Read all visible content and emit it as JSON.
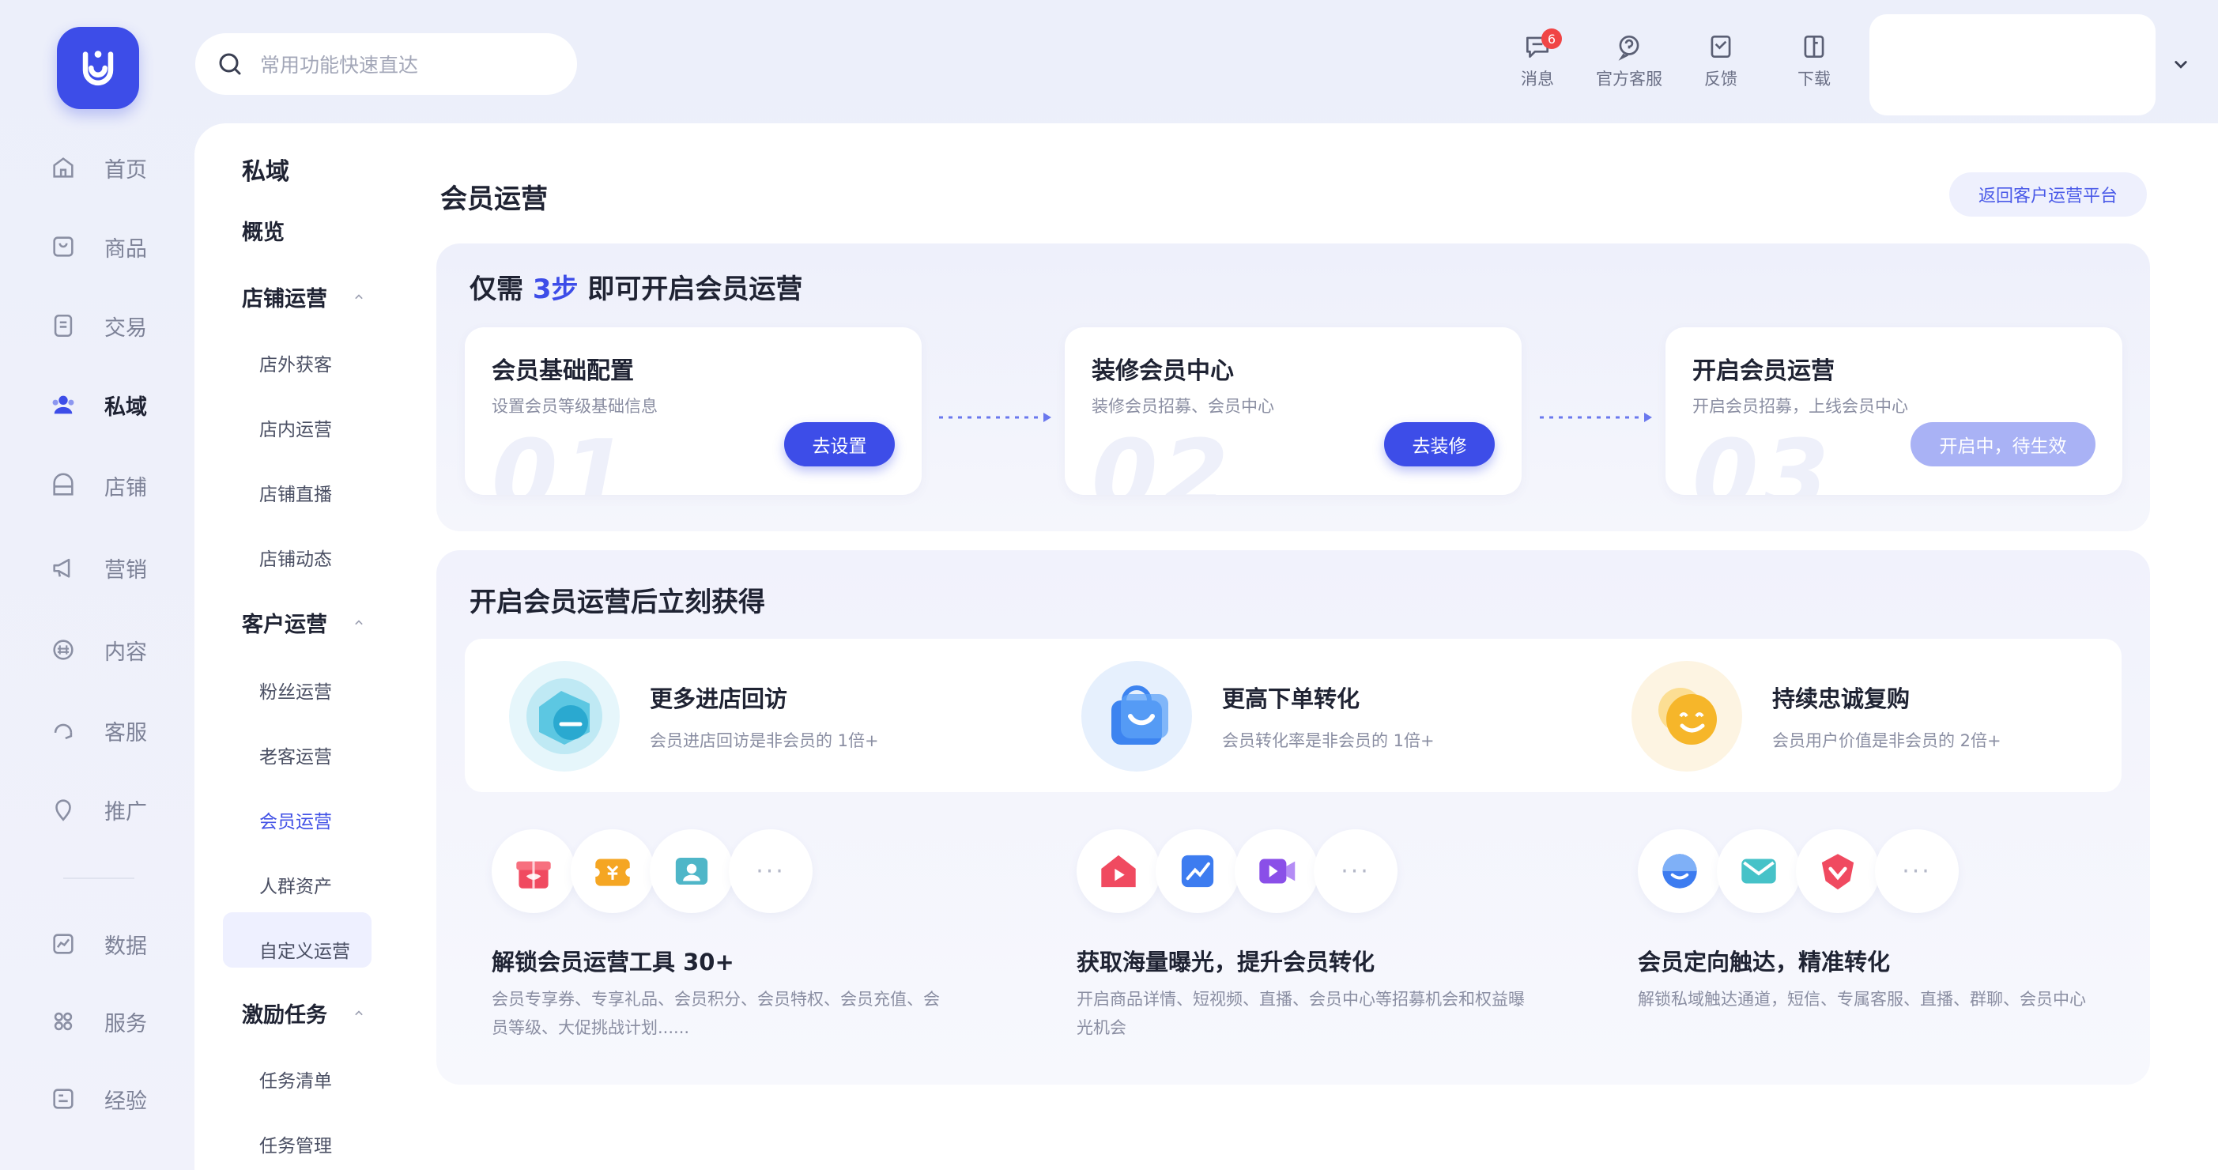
{
  "nav": {
    "items": [
      {
        "label": "首页",
        "icon": "home-icon"
      },
      {
        "label": "商品",
        "icon": "goods-icon"
      },
      {
        "label": "交易",
        "icon": "trade-icon"
      },
      {
        "label": "私域",
        "icon": "users-icon"
      },
      {
        "label": "店铺",
        "icon": "store-icon"
      },
      {
        "label": "营销",
        "icon": "megaphone-icon"
      },
      {
        "label": "内容",
        "icon": "content-icon"
      },
      {
        "label": "客服",
        "icon": "headset-icon"
      },
      {
        "label": "推广",
        "icon": "location-icon"
      },
      {
        "label": "数据",
        "icon": "chart-icon"
      },
      {
        "label": "服务",
        "icon": "grid-icon"
      },
      {
        "label": "经验",
        "icon": "book-icon"
      }
    ],
    "active": "私域"
  },
  "search": {
    "placeholder": "常用功能快速直达"
  },
  "header": {
    "tools": [
      {
        "label": "消息",
        "icon": "message-icon",
        "badge": "6"
      },
      {
        "label": "官方客服",
        "icon": "service-icon"
      },
      {
        "label": "反馈",
        "icon": "feedback-icon"
      },
      {
        "label": "下载",
        "icon": "download-icon"
      }
    ]
  },
  "subnav": {
    "title": "私域",
    "overview": "概览",
    "groups": [
      {
        "label": "店铺运营",
        "children": [
          "店外获客",
          "店内运营",
          "店铺直播",
          "店铺动态"
        ]
      },
      {
        "label": "客户运营",
        "children": [
          "粉丝运营",
          "老客运营",
          "会员运营",
          "人群资产",
          "自定义运营"
        ]
      },
      {
        "label": "激励任务",
        "children": [
          "任务清单",
          "任务管理"
        ]
      }
    ],
    "active": "会员运营"
  },
  "page": {
    "title": "会员运营",
    "back_label": "返回客户运营平台"
  },
  "steps": {
    "title_prefix": "仅需",
    "title_highlight": "3步",
    "title_suffix": "即可开启会员运营",
    "accent_color": "#3d4de8",
    "items": [
      {
        "title": "会员基础配置",
        "desc": "设置会员等级基础信息",
        "num": "01",
        "button": "去设置"
      },
      {
        "title": "装修会员中心",
        "desc": "装修会员招募、会员中心",
        "num": "02",
        "button": "去装修"
      },
      {
        "title": "开启会员运营",
        "desc": "开启会员招募，上线会员中心",
        "num": "03",
        "button": "开启中，待生效"
      }
    ]
  },
  "benefits": {
    "title": "开启会员运营后立刻获得",
    "items": [
      {
        "title": "更多进店回访",
        "desc": "会员进店回访是非会员的 1倍+"
      },
      {
        "title": "更高下单转化",
        "desc": "会员转化率是非会员的 1倍+"
      },
      {
        "title": "持续忠诚复购",
        "desc": "会员用户价值是非会员的 2倍+"
      }
    ]
  },
  "tools": [
    {
      "title": "解锁会员运营工具 30+",
      "desc": "会员专享券、专享礼品、会员积分、会员特权、会员充值、会员等级、大促挑战计划......",
      "more": "···"
    },
    {
      "title": "获取海量曝光，提升会员转化",
      "desc": "开启商品详情、短视频、直播、会员中心等招募机会和权益曝光机会",
      "more": "···"
    },
    {
      "title": "会员定向触达，精准转化",
      "desc": "解锁私域触达通道，短信、专属客服、直播、群聊、会员中心",
      "more": "···"
    }
  ]
}
